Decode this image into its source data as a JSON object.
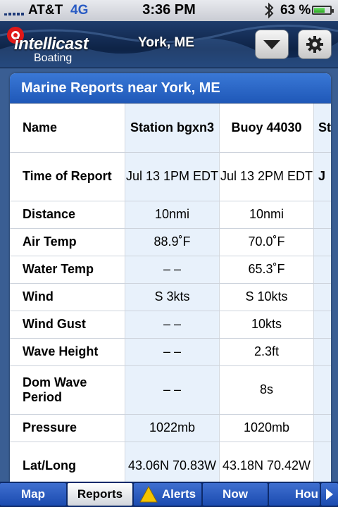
{
  "status": {
    "carrier": "AT&T",
    "network": "4G",
    "time": "3:36 PM",
    "battery": "63 %"
  },
  "header": {
    "brand": "intellicast",
    "subbrand": "Boating",
    "location": "York, ME",
    "dropdown_icon": "triangle-down-icon",
    "settings_icon": "gear-icon"
  },
  "panel": {
    "title": "Marine Reports near York, ME"
  },
  "table": {
    "columns": [
      "Name",
      "Station bgxn3",
      "Buoy 44030",
      "St"
    ],
    "rows": [
      {
        "label": "Time of Report",
        "values": [
          "Jul 13 1PM EDT",
          "Jul 13 2PM EDT",
          "J"
        ]
      },
      {
        "label": "Distance",
        "values": [
          "10nmi",
          "10nmi",
          ""
        ]
      },
      {
        "label": "Air Temp",
        "values": [
          "88.9˚F",
          "70.0˚F",
          ""
        ]
      },
      {
        "label": "Water Temp",
        "values": [
          "– –",
          "65.3˚F",
          ""
        ]
      },
      {
        "label": "Wind",
        "values": [
          "S 3kts",
          "S 10kts",
          ""
        ]
      },
      {
        "label": "Wind Gust",
        "values": [
          "– –",
          "10kts",
          ""
        ]
      },
      {
        "label": "Wave Height",
        "values": [
          "– –",
          "2.3ft",
          ""
        ]
      },
      {
        "label": "Dom Wave Period",
        "values": [
          "– –",
          "8s",
          ""
        ]
      },
      {
        "label": "Pressure",
        "values": [
          "1022mb",
          "1020mb",
          ""
        ]
      },
      {
        "label": "Lat/Long",
        "values": [
          "43.06N 70.83W",
          "43.18N 70.42W",
          ""
        ]
      }
    ]
  },
  "tabs": [
    {
      "label": "Map",
      "active": false
    },
    {
      "label": "Reports",
      "active": true
    },
    {
      "label": "Alerts",
      "active": false,
      "icon": "warning-icon"
    },
    {
      "label": "Now",
      "active": false
    },
    {
      "label": "Hou",
      "active": false
    }
  ],
  "colors": {
    "accent": "#1f58b8",
    "header_bg": "#0e2346",
    "tab_bg": "#1b4bb0"
  }
}
